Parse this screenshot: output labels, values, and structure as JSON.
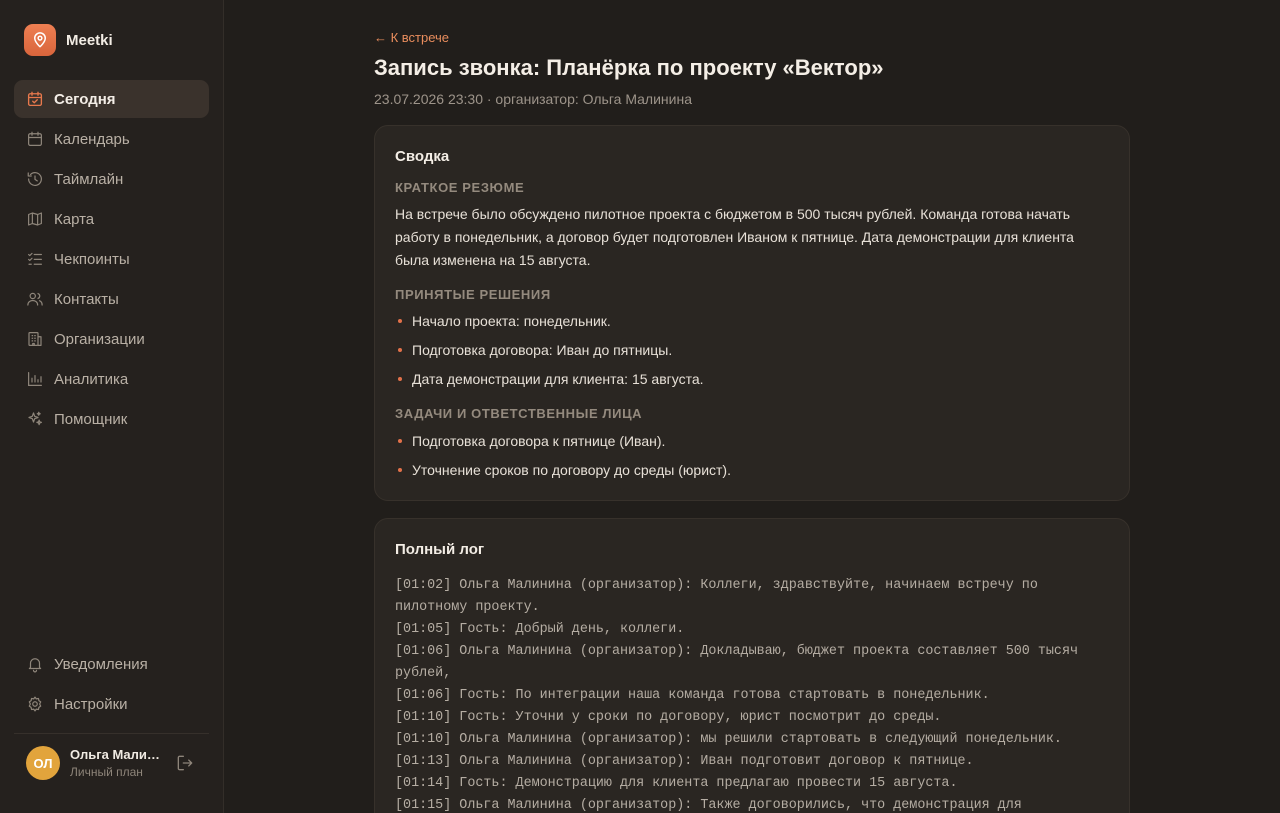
{
  "brand": {
    "name": "Meetki"
  },
  "nav": {
    "items": [
      {
        "label": "Сегодня",
        "icon": "calendar-check-icon",
        "active": true
      },
      {
        "label": "Календарь",
        "icon": "calendar-icon"
      },
      {
        "label": "Таймлайн",
        "icon": "history-icon"
      },
      {
        "label": "Карта",
        "icon": "map-icon"
      },
      {
        "label": "Чекпоинты",
        "icon": "checklist-icon"
      },
      {
        "label": "Контакты",
        "icon": "users-icon"
      },
      {
        "label": "Организации",
        "icon": "building-icon"
      },
      {
        "label": "Аналитика",
        "icon": "bar-chart-icon"
      },
      {
        "label": "Помощник",
        "icon": "sparkles-icon"
      }
    ],
    "bottom": [
      {
        "label": "Уведомления",
        "icon": "bell-icon"
      },
      {
        "label": "Настройки",
        "icon": "gear-icon"
      }
    ]
  },
  "user": {
    "initials": "ОЛ",
    "name": "Ольга Малин…",
    "plan": "Личный план"
  },
  "colors": {
    "accent": "#e7784c",
    "background": "#211e1b",
    "card": "#2a2622",
    "avatar": "#e2a43c"
  },
  "page": {
    "back_label": "← К встрече",
    "title": "Запись звонка: Планёрка по проекту «Вектор»",
    "meta": "23.07.2026 23:30 · организатор: Ольга Малинина"
  },
  "summary": {
    "title": "Сводка",
    "brief_label": "КРАТКОЕ РЕЗЮМЕ",
    "brief_text": "На встрече было обсуждено пилотное проекта с бюджетом в 500 тысяч рублей. Команда готова начать работу в понедельник, а договор будет подготовлен Иваном к пятнице. Дата демонстрации для клиента была изменена на 15 августа.",
    "decisions_label": "ПРИНЯТЫЕ РЕШЕНИЯ",
    "decisions": [
      "Начало проекта: понедельник.",
      "Подготовка договора: Иван до пятницы.",
      "Дата демонстрации для клиента: 15 августа."
    ],
    "tasks_label": "ЗАДАЧИ И ОТВЕТСТВЕННЫЕ ЛИЦА",
    "tasks": [
      "Подготовка договора к пятнице (Иван).",
      "Уточнение сроков по договору до среды (юрист)."
    ]
  },
  "log": {
    "title": "Полный лог",
    "lines": [
      "[01:02] Ольга Малинина (организатор): Коллеги, здравствуйте, начинаем встречу по пилотному проекту.",
      "[01:05] Гость: Добрый день, коллеги.",
      "[01:06] Ольга Малинина (организатор): Докладываю, бюджет проекта составляет 500 тысяч рублей,",
      "[01:06] Гость: По интеграции наша команда готова стартовать в понедельник.",
      "[01:10] Гость: Уточни у сроки по договору, юрист посмотрит до среды.",
      "[01:10] Ольга Малинина (организатор): мы решили стартовать в следующий понедельник.",
      "[01:13] Ольга Малинина (организатор): Иван подготовит договор к пятнице.",
      "[01:14] Гость: Демонстрацию для клиента предлагаю провести 15 августа.",
      "[01:15] Ольга Малинина (организатор): Также договорились, что демонстрация для"
    ]
  }
}
